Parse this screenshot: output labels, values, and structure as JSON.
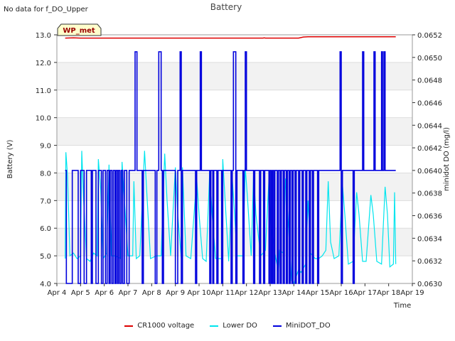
{
  "note": "No data for f_DO_Upper",
  "chart_data": {
    "type": "line",
    "title": "Battery",
    "xlabel": "Time",
    "ylabel_left": "Battery (V)",
    "ylabel_right": "minidot DO (mg/l)",
    "annotation": "WP_met",
    "xlim": [
      4,
      19
    ],
    "x_ticks": [
      {
        "value": 4,
        "label": "Apr 4"
      },
      {
        "value": 5,
        "label": "Apr 5"
      },
      {
        "value": 6,
        "label": "Apr 6"
      },
      {
        "value": 7,
        "label": "Apr 7"
      },
      {
        "value": 8,
        "label": "Apr 8"
      },
      {
        "value": 9,
        "label": "Apr 9"
      },
      {
        "value": 10,
        "label": "Apr 10"
      },
      {
        "value": 11,
        "label": "Apr 11"
      },
      {
        "value": 12,
        "label": "Apr 12"
      },
      {
        "value": 13,
        "label": "Apr 13"
      },
      {
        "value": 14,
        "label": "Apr 14"
      },
      {
        "value": 15,
        "label": "Apr 15"
      },
      {
        "value": 16,
        "label": "Apr 16"
      },
      {
        "value": 17,
        "label": "Apr 17"
      },
      {
        "value": 18,
        "label": "Apr 18"
      },
      {
        "value": 19,
        "label": "Apr 19"
      }
    ],
    "ylim_left": [
      4.0,
      13.0
    ],
    "y_ticks_left": [
      "4.0",
      "5.0",
      "6.0",
      "7.0",
      "8.0",
      "9.0",
      "10.0",
      "11.0",
      "12.0",
      "13.0"
    ],
    "ylim_right": [
      0.063,
      0.0652
    ],
    "y_ticks_right": [
      "0.0630",
      "0.0632",
      "0.0634",
      "0.0636",
      "0.0638",
      "0.0640",
      "0.0642",
      "0.0644",
      "0.0646",
      "0.0648",
      "0.0650",
      "0.0652"
    ],
    "grid": "horizontal bands",
    "legend_position": "bottom",
    "series": [
      {
        "name": "CR1000 voltage",
        "color": "#dd0000",
        "axis": "left",
        "points": [
          [
            4.35,
            12.88
          ],
          [
            4.7,
            12.89
          ],
          [
            5.0,
            12.88
          ],
          [
            6.0,
            12.88
          ],
          [
            7.0,
            12.88
          ],
          [
            8.0,
            12.88
          ],
          [
            9.0,
            12.88
          ],
          [
            10.0,
            12.88
          ],
          [
            11.0,
            12.88
          ],
          [
            12.0,
            12.88
          ],
          [
            12.7,
            12.88
          ],
          [
            12.75,
            12.89
          ],
          [
            12.8,
            12.88
          ],
          [
            13.5,
            12.88
          ],
          [
            14.2,
            12.88
          ],
          [
            14.4,
            12.92
          ],
          [
            14.6,
            12.93
          ],
          [
            15.0,
            12.93
          ],
          [
            16.0,
            12.93
          ],
          [
            17.0,
            12.93
          ],
          [
            18.0,
            12.93
          ],
          [
            18.3,
            12.93
          ]
        ]
      },
      {
        "name": "Lower DO",
        "color": "#00e5ee",
        "axis": "left",
        "points": [
          [
            4.35,
            4.9
          ],
          [
            4.38,
            8.75
          ],
          [
            4.45,
            7.9
          ],
          [
            4.55,
            5.0
          ],
          [
            4.7,
            5.1
          ],
          [
            4.85,
            4.9
          ],
          [
            5.0,
            5.0
          ],
          [
            5.05,
            8.8
          ],
          [
            5.12,
            7.2
          ],
          [
            5.25,
            4.9
          ],
          [
            5.4,
            4.8
          ],
          [
            5.55,
            5.1
          ],
          [
            5.7,
            5.0
          ],
          [
            5.75,
            8.5
          ],
          [
            5.85,
            7.4
          ],
          [
            5.95,
            4.9
          ],
          [
            6.1,
            5.1
          ],
          [
            6.2,
            8.3
          ],
          [
            6.3,
            5.0
          ],
          [
            6.45,
            5.0
          ],
          [
            6.7,
            4.9
          ],
          [
            6.75,
            8.4
          ],
          [
            6.85,
            7.0
          ],
          [
            7.0,
            5.0
          ],
          [
            7.2,
            5.0
          ],
          [
            7.25,
            7.7
          ],
          [
            7.35,
            4.9
          ],
          [
            7.5,
            5.0
          ],
          [
            7.7,
            8.8
          ],
          [
            7.8,
            7.2
          ],
          [
            7.95,
            4.9
          ],
          [
            8.2,
            5.0
          ],
          [
            8.4,
            5.0
          ],
          [
            8.55,
            8.7
          ],
          [
            8.65,
            7.0
          ],
          [
            8.8,
            5.0
          ],
          [
            9.0,
            8.2
          ],
          [
            9.1,
            6.5
          ],
          [
            9.25,
            4.9
          ],
          [
            9.3,
            8.2
          ],
          [
            9.45,
            5.0
          ],
          [
            9.65,
            4.9
          ],
          [
            9.9,
            7.8
          ],
          [
            10.0,
            6.5
          ],
          [
            10.15,
            4.9
          ],
          [
            10.3,
            4.8
          ],
          [
            10.45,
            8.1
          ],
          [
            10.55,
            6.5
          ],
          [
            10.7,
            4.9
          ],
          [
            10.95,
            4.9
          ],
          [
            11.0,
            8.5
          ],
          [
            11.1,
            7.0
          ],
          [
            11.25,
            4.8
          ],
          [
            11.4,
            7.8
          ],
          [
            11.5,
            6.5
          ],
          [
            11.6,
            5.0
          ],
          [
            11.85,
            5.0
          ],
          [
            11.95,
            8.2
          ],
          [
            12.05,
            7.0
          ],
          [
            12.2,
            5.0
          ],
          [
            12.3,
            8.0
          ],
          [
            12.4,
            6.5
          ],
          [
            12.6,
            5.0
          ],
          [
            12.8,
            5.2
          ],
          [
            12.95,
            7.8
          ],
          [
            13.05,
            6.0
          ],
          [
            13.2,
            5.1
          ],
          [
            13.35,
            4.4
          ],
          [
            13.4,
            5.2
          ],
          [
            13.55,
            5.1
          ],
          [
            13.65,
            7.8
          ],
          [
            13.75,
            6.4
          ],
          [
            13.9,
            4.1
          ],
          [
            14.0,
            4.0
          ],
          [
            14.2,
            4.5
          ],
          [
            14.3,
            4.4
          ],
          [
            14.5,
            4.7
          ],
          [
            14.6,
            7.0
          ],
          [
            14.7,
            5.1
          ],
          [
            14.9,
            4.9
          ],
          [
            15.05,
            4.9
          ],
          [
            15.2,
            5.0
          ],
          [
            15.35,
            5.2
          ],
          [
            15.45,
            7.7
          ],
          [
            15.55,
            5.5
          ],
          [
            15.7,
            4.9
          ],
          [
            15.9,
            5.0
          ],
          [
            16.05,
            7.6
          ],
          [
            16.15,
            6.5
          ],
          [
            16.3,
            4.7
          ],
          [
            16.5,
            4.8
          ],
          [
            16.65,
            7.3
          ],
          [
            16.75,
            6.5
          ],
          [
            16.9,
            4.8
          ],
          [
            17.05,
            4.8
          ],
          [
            17.25,
            7.2
          ],
          [
            17.35,
            6.5
          ],
          [
            17.5,
            4.8
          ],
          [
            17.7,
            4.7
          ],
          [
            17.85,
            7.5
          ],
          [
            17.95,
            6.5
          ],
          [
            18.05,
            4.6
          ],
          [
            18.2,
            4.7
          ],
          [
            18.25,
            7.3
          ],
          [
            18.3,
            4.7
          ]
        ]
      },
      {
        "name": "MiniDOT_DO",
        "color": "#0000dd",
        "axis": "right",
        "baseline": 0.064,
        "low": 0.063,
        "high": 0.06505,
        "x_range": [
          4.35,
          18.3
        ],
        "dips": [
          [
            4.4,
            4.65
          ],
          [
            4.9,
            5.0
          ],
          [
            5.15,
            5.25
          ],
          [
            5.45,
            5.5
          ],
          [
            5.65,
            5.75
          ],
          [
            5.88,
            5.95
          ],
          [
            6.05,
            6.12
          ],
          [
            6.2,
            6.25
          ],
          [
            6.32,
            6.38
          ],
          [
            6.45,
            6.5
          ],
          [
            6.56,
            6.6
          ],
          [
            6.66,
            6.72
          ],
          [
            6.78,
            6.85
          ],
          [
            6.95,
            7.05
          ],
          [
            7.6,
            7.65
          ],
          [
            8.15,
            8.22
          ],
          [
            8.45,
            8.5
          ],
          [
            9.0,
            9.1
          ],
          [
            9.25,
            9.3
          ],
          [
            9.85,
            9.9
          ],
          [
            10.45,
            10.5
          ],
          [
            10.58,
            10.62
          ],
          [
            10.75,
            10.8
          ],
          [
            10.95,
            11.0
          ],
          [
            11.35,
            11.4
          ],
          [
            11.55,
            11.6
          ],
          [
            11.85,
            11.9
          ],
          [
            12.3,
            12.35
          ],
          [
            12.55,
            12.6
          ],
          [
            12.72,
            12.77
          ],
          [
            12.95,
            13.0
          ],
          [
            13.05,
            13.1
          ],
          [
            13.15,
            13.2
          ],
          [
            13.3,
            13.35
          ],
          [
            13.42,
            13.47
          ],
          [
            13.55,
            13.6
          ],
          [
            13.68,
            13.73
          ],
          [
            13.8,
            13.85
          ],
          [
            13.92,
            13.97
          ],
          [
            14.05,
            14.1
          ],
          [
            14.2,
            14.25
          ],
          [
            14.35,
            14.4
          ],
          [
            14.5,
            14.55
          ],
          [
            14.65,
            14.7
          ],
          [
            14.78,
            14.83
          ],
          [
            15.0,
            15.05
          ],
          [
            16.0,
            16.05
          ],
          [
            16.5,
            16.55
          ]
        ],
        "spikes": [
          [
            7.3,
            7.38
          ],
          [
            8.3,
            8.4
          ],
          [
            9.2,
            9.25
          ],
          [
            10.05,
            10.1
          ],
          [
            11.45,
            11.55
          ],
          [
            11.95,
            12.0
          ],
          [
            15.95,
            16.0
          ],
          [
            16.9,
            16.95
          ],
          [
            17.38,
            17.43
          ],
          [
            17.7,
            17.74
          ],
          [
            17.8,
            17.85
          ]
        ]
      }
    ]
  }
}
